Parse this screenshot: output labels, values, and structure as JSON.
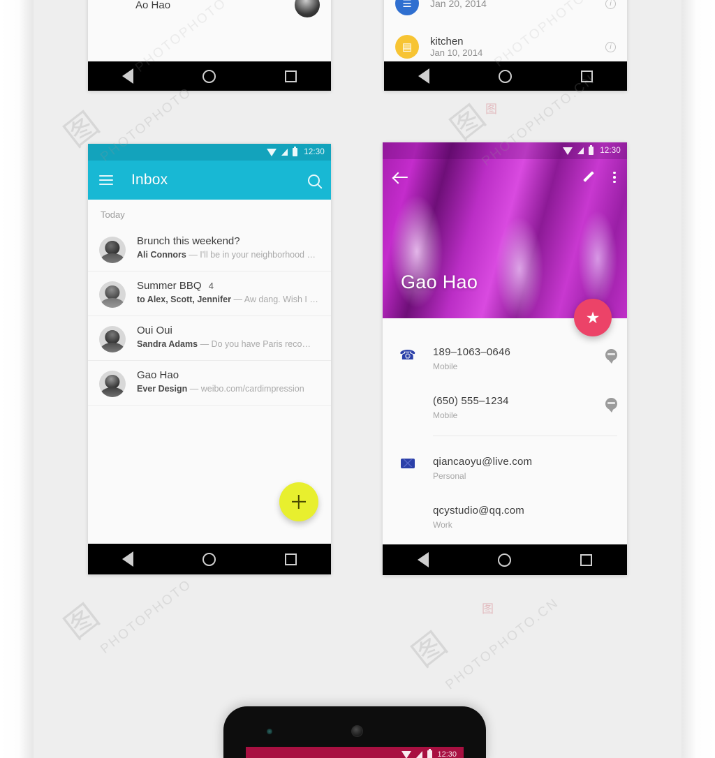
{
  "watermark": {
    "text": "PHOTOPHOTO",
    "text_cn": "PHOTOPHOTO.CN",
    "logo_glyph": "图",
    "seal_glyph": "图"
  },
  "screens": {
    "top_left_partial": {
      "name": "Ao Hao",
      "navbar": {
        "back": "◁",
        "home": "○",
        "recent": "□"
      }
    },
    "top_right_partial": {
      "items": [
        {
          "title": "",
          "date": "Jan 20, 2014",
          "icon": "document-icon",
          "color": "#2f6fd0",
          "glyph": "☰"
        },
        {
          "title": "kitchen",
          "date": "Jan 10, 2014",
          "icon": "folder-icon",
          "color": "#f7c433",
          "glyph": "▤"
        }
      ],
      "info_glyph": "i"
    },
    "inbox": {
      "statusbar": {
        "time": "12:30",
        "wifi": "wifi-icon",
        "signal": "signal-icon",
        "battery": "battery-icon"
      },
      "appbar": {
        "menu_icon": "hamburger-menu-icon",
        "title": "Inbox",
        "search_icon": "search-icon",
        "bg_color": "#18b8d4"
      },
      "section_label": "Today",
      "messages": [
        {
          "subject": "Brunch this weekend?",
          "count": "",
          "sender": "Ali Connors",
          "snippet": "— I'll be in your neighborhood …"
        },
        {
          "subject": "Summer BBQ",
          "count": "4",
          "sender": "to Alex, Scott, Jennifer",
          "snippet": "— Aw dang. Wish I …"
        },
        {
          "subject": "Oui Oui",
          "count": "",
          "sender": "Sandra Adams",
          "snippet": "— Do you have Paris reco…"
        },
        {
          "subject": "Gao Hao",
          "count": "",
          "sender": "Ever Design",
          "snippet": "— weibo.com/cardimpression"
        }
      ],
      "fab": {
        "label": "+",
        "name": "compose-fab",
        "color": "#e8ef2e"
      },
      "navbar": {
        "back": "back-nav-icon",
        "home": "home-nav-icon",
        "recent": "recents-nav-icon"
      }
    },
    "contact": {
      "statusbar": {
        "time": "12:30"
      },
      "toolbar": {
        "back_icon": "back-arrow-icon",
        "edit_icon": "pencil-edit-icon",
        "overflow_icon": "overflow-menu-icon"
      },
      "hero_name": "Gao Hao",
      "favorite_fab": {
        "glyph": "★",
        "name": "favorite-star-fab",
        "color": "#ec4368"
      },
      "phone_section": {
        "icon": "phone-icon",
        "entries": [
          {
            "value": "189–1063–0646",
            "label": "Mobile",
            "action_icon": "message-bubble-icon"
          },
          {
            "value": "(650) 555–1234",
            "label": "Mobile",
            "action_icon": "message-bubble-icon"
          }
        ]
      },
      "email_section": {
        "icon": "email-icon",
        "entries": [
          {
            "value": "qiancaoyu@live.com",
            "label": "Personal"
          },
          {
            "value": "qcystudio@qq.com",
            "label": "Work"
          }
        ]
      },
      "navbar": {
        "back": "back-nav-icon",
        "home": "home-nav-icon",
        "recent": "recents-nav-icon"
      }
    },
    "bottom_device": {
      "statusbar": {
        "time": "12:30"
      },
      "screen_color": "#a81041"
    }
  }
}
